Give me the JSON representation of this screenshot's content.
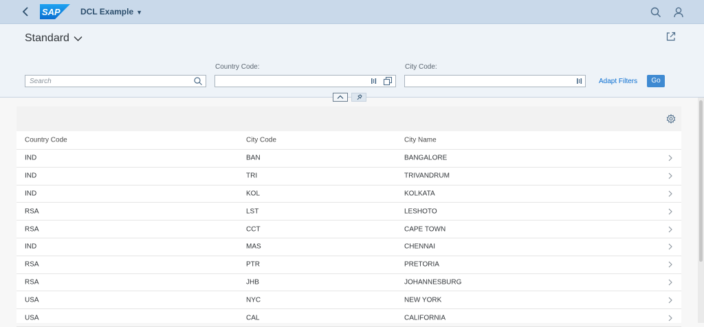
{
  "shell": {
    "logo_text": "SAP",
    "app_title": "DCL Example"
  },
  "header": {
    "variant": "Standard",
    "search_placeholder": "Search",
    "filters": [
      {
        "label": "Country Code:",
        "value": ""
      },
      {
        "label": "City Code:",
        "value": ""
      }
    ],
    "adapt_filters": "Adapt Filters",
    "go": "Go"
  },
  "table": {
    "columns": [
      "Country Code",
      "City Code",
      "City Name"
    ],
    "rows": [
      [
        "IND",
        "BAN",
        "BANGALORE"
      ],
      [
        "IND",
        "TRI",
        "TRIVANDRUM"
      ],
      [
        "IND",
        "KOL",
        "KOLKATA"
      ],
      [
        "RSA",
        "LST",
        "LESHOTO"
      ],
      [
        "RSA",
        "CCT",
        "CAPE TOWN"
      ],
      [
        "IND",
        "MAS",
        "CHENNAI"
      ],
      [
        "RSA",
        "PTR",
        "PRETORIA"
      ],
      [
        "RSA",
        "JHB",
        "JOHANNESBURG"
      ],
      [
        "USA",
        "NYC",
        "NEW YORK"
      ],
      [
        "USA",
        "CAL",
        "CALIFORNIA"
      ]
    ]
  },
  "colors": {
    "shell": "#c9d9ea",
    "accent": "#0a6ed1",
    "go_button": "#3f8ad2"
  }
}
